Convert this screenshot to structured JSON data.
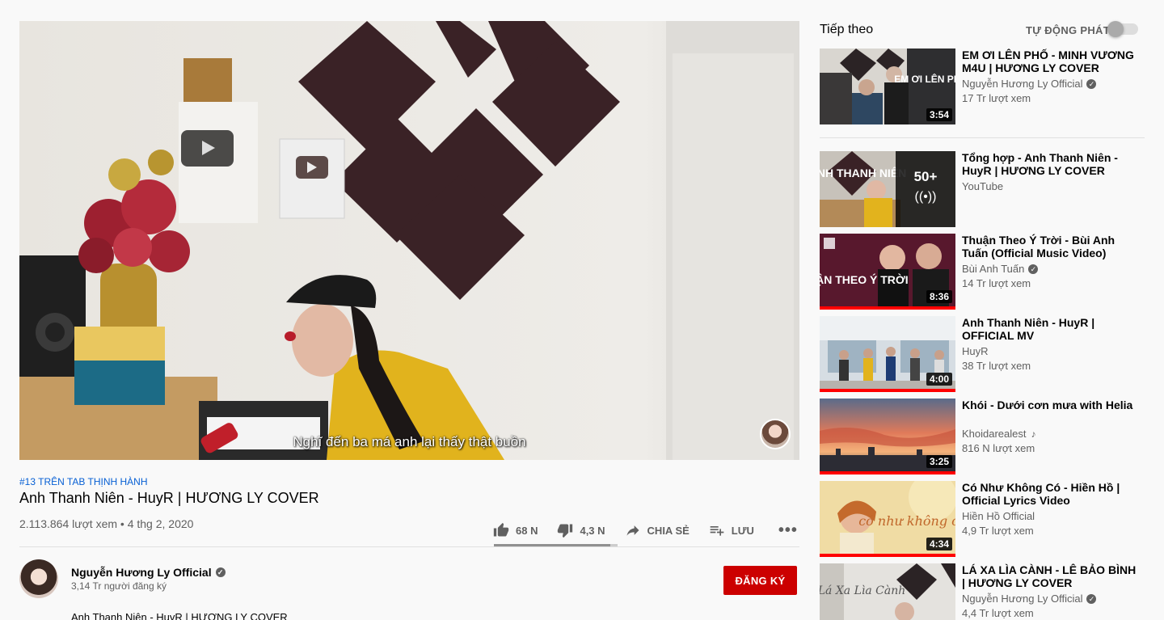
{
  "video": {
    "subtitle": "Nghĩ đến ba má anh lại thấy thật buồn",
    "trending_tag": "#13 TRÊN TAB THỊNH HÀNH",
    "title": "Anh Thanh Niên - HuyR | HƯƠNG LY COVER",
    "views_date": "2.113.864 lượt xem • 4 thg 2, 2020",
    "likes": "68 N",
    "dislikes": "4,3 N",
    "like_ratio": 0.94,
    "share_label": "CHIA SẺ",
    "save_label": "LƯU",
    "more_label": "•••"
  },
  "owner": {
    "name": "Nguyễn Hương Ly Official",
    "subscribers": "3,14 Tr người đăng ký",
    "subscribe_label": "ĐĂNG KÝ",
    "description": "Anh Thanh Niên - HuyR | HƯƠNG LY COVER"
  },
  "sidebar": {
    "up_next_label": "Tiếp theo",
    "autoplay_label": "TỰ ĐỘNG PHÁT",
    "autoplay_on": false,
    "items": [
      {
        "title": "EM ƠI LÊN PHỐ - MINH VƯƠNG M4U | HƯƠNG LY COVER",
        "channel": "Nguyễn Hương Ly Official",
        "views": "17 Tr lượt xem",
        "duration": "3:54"
      },
      {
        "title": "Tổng hợp - Anh Thanh Niên - HuyR | HƯƠNG LY COVER",
        "channel": "YouTube",
        "views": "",
        "playlist_count": "50+",
        "playlist_icon": "((•))"
      },
      {
        "title": "Thuận Theo Ý Trời - Bùi Anh Tuấn (Official Music Video)",
        "channel": "Bùi Anh Tuấn",
        "views": "14 Tr lượt xem",
        "duration": "8:36"
      },
      {
        "title": "Anh Thanh Niên - HuyR | OFFICIAL MV",
        "channel": "HuyR",
        "views": "38 Tr lượt xem",
        "duration": "4:00"
      },
      {
        "title": "Khói - Dưới cơn mưa with Helia",
        "channel": "Khoidarealest",
        "views": "816 N lượt xem",
        "duration": "3:25"
      },
      {
        "title": "Có Như Không Có - Hiền Hồ | Official Lyrics Video",
        "channel": "Hiền Hồ Official",
        "views": "4,9 Tr lượt xem",
        "duration": "4:34"
      },
      {
        "title": "LÁ XA LÌA CÀNH - LÊ BẢO BÌNH | HƯƠNG LY COVER",
        "channel": "Nguyễn Hương Ly Official",
        "views": "4,4 Tr lượt xem",
        "duration": ""
      }
    ]
  },
  "thumbnail_text": {
    "t1": "EM ƠI LÊN PHỐ",
    "t2": "ANH THANH NIÊN",
    "t3": "THUẬN THEO Ý TRỜI",
    "t6": "có như không có",
    "t7": "Lá Xa Lìa Cành"
  },
  "colors": {
    "accent_red": "#cc0000",
    "progress_red": "#ff0000",
    "link_blue": "#065fd4",
    "text_secondary": "#606060"
  }
}
